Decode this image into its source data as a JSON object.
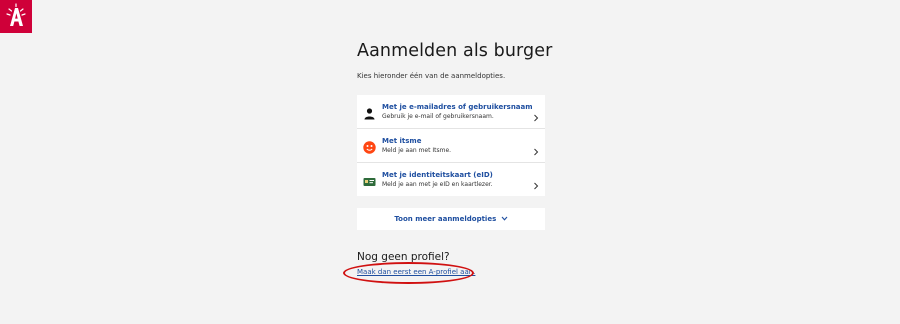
{
  "brand": {
    "logo_letter": "A",
    "color": "#cf0039"
  },
  "page": {
    "title": "Aanmelden als burger",
    "subtitle": "Kies hieronder één van de aanmeldopties."
  },
  "options": [
    {
      "icon": "user-icon",
      "title": "Met je e-mailadres of gebruikersnaam",
      "description": "Gebruik je e-mail of gebruikersnaam."
    },
    {
      "icon": "itsme-icon",
      "title": "Met itsme",
      "description": "Meld je aan met Itsme."
    },
    {
      "icon": "eid-card-icon",
      "title": "Met je identiteitskaart (eID)",
      "description": "Meld je aan met je eID en kaartlezer."
    }
  ],
  "more_options": {
    "label": "Toon meer aanmeldopties"
  },
  "no_profile": {
    "heading": "Nog geen profiel?",
    "link": "Maak dan eerst een A-profiel aan."
  },
  "colors": {
    "link": "#1f4fa0",
    "annotation": "#d01010",
    "background": "#f3f3f3"
  }
}
